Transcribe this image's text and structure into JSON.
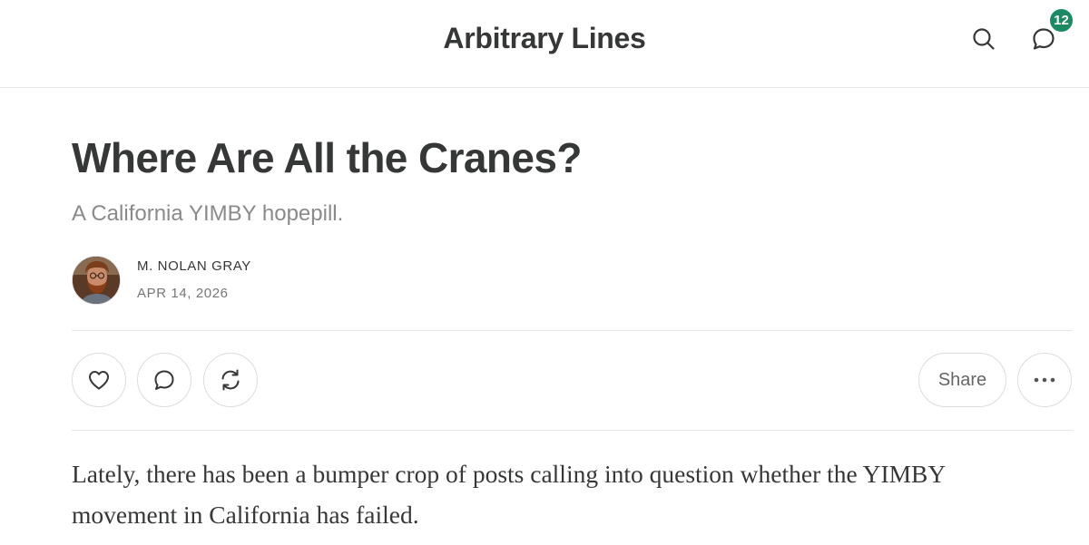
{
  "header": {
    "site_title": "Arbitrary Lines",
    "search_icon": "search-icon",
    "chat_icon": "chat-bubble-icon",
    "chat_badge_count": "12",
    "badge_color": "#1b8a63"
  },
  "post": {
    "title": "Where Are All the Cranes?",
    "subtitle": "A California YIMBY hopepill.",
    "author": {
      "name": "M. NOLAN GRAY",
      "avatar_icon": "author-avatar"
    },
    "date": "APR 14, 2026",
    "body_first_paragraph": "Lately, there has been a bumper crop of posts calling into question whether the YIMBY movement in California has failed."
  },
  "actions": {
    "like_icon": "heart-icon",
    "comment_icon": "comment-icon",
    "restack_icon": "restack-icon",
    "share_label": "Share",
    "more_icon": "ellipsis-icon"
  }
}
